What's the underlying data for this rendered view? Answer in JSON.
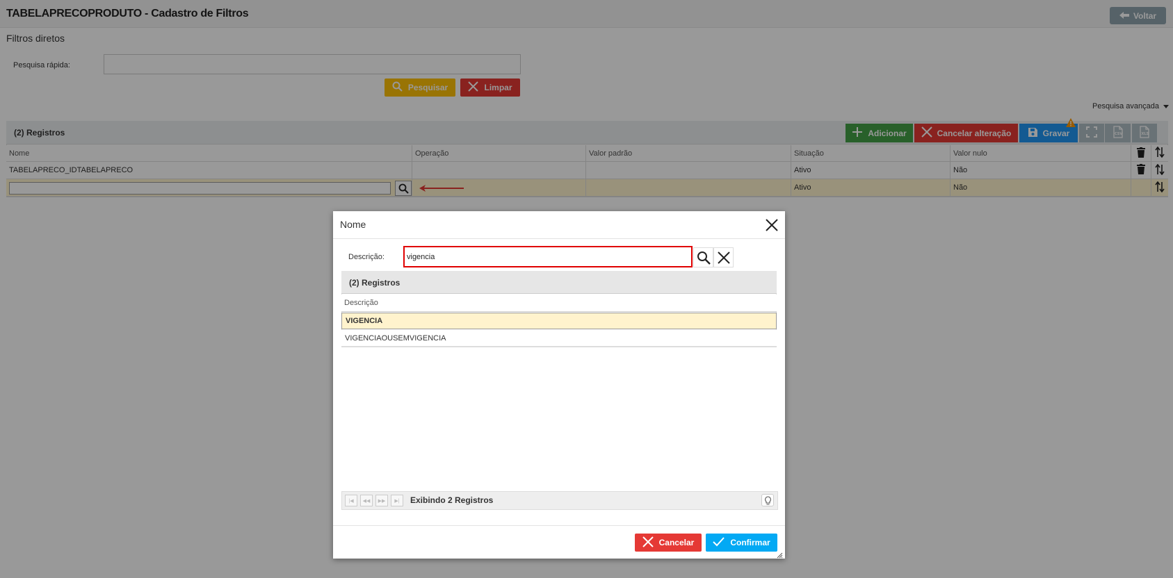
{
  "header": {
    "title": "TABELAPRECOPRODUTO - Cadastro de Filtros",
    "back_label": "Voltar"
  },
  "filters": {
    "section_title": "Filtros diretos",
    "quick_search_label": "Pesquisa rápida:",
    "quick_search_value": "",
    "search_label": "Pesquisar",
    "clear_label": "Limpar",
    "advanced_label": "Pesquisa avançada"
  },
  "grid": {
    "count_label": "(2) Registros",
    "toolbar": {
      "add_label": "Adicionar",
      "cancel_change_label": "Cancelar alteração",
      "save_label": "Gravar"
    },
    "columns": [
      "Nome",
      "Operação",
      "Valor padrão",
      "Situação",
      "Valor nulo"
    ],
    "rows": [
      {
        "nome": "TABELAPRECO_IDTABELAPRECO",
        "operacao": "",
        "valor_padrao": "",
        "situacao": "Ativo",
        "valor_nulo": "Não"
      },
      {
        "nome": "",
        "operacao": "",
        "valor_padrao": "",
        "situacao": "Ativo",
        "valor_nulo": "Não"
      }
    ]
  },
  "modal": {
    "title": "Nome",
    "description_label": "Descrição:",
    "description_value": "vigencia",
    "count_label": "(2) Registros",
    "column": "Descrição",
    "rows": [
      "VIGENCIA",
      "VIGENCIAOUSEMVIGENCIA"
    ],
    "pager_text": "Exibindo 2 Registros",
    "cancel_label": "Cancelar",
    "confirm_label": "Confirmar"
  },
  "colors": {
    "accent_yellow": "#ffc107",
    "danger": "#e53935",
    "success": "#43a047",
    "primary": "#2196f3",
    "confirm": "#03a9f4",
    "selected_row": "#fff3cd",
    "highlight_border": "#e00000"
  }
}
